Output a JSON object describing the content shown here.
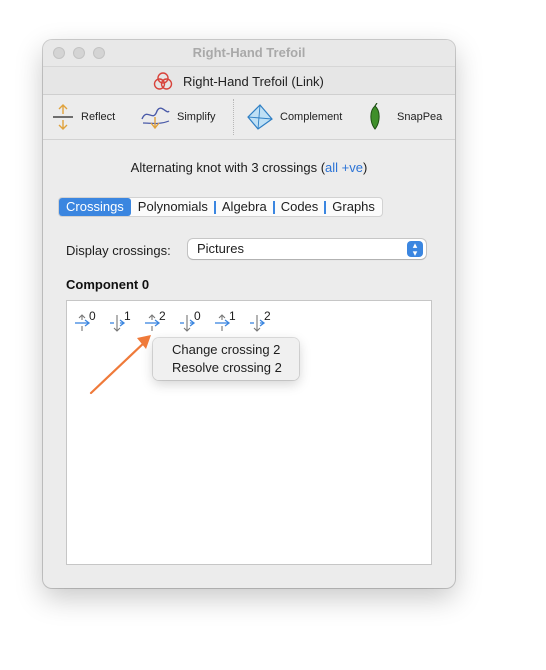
{
  "window": {
    "title": "Right-Hand Trefoil",
    "link_title": "Right-Hand Trefoil (Link)"
  },
  "toolbar": {
    "reflect_label": "Reflect",
    "simplify_label": "Simplify",
    "complement_label": "Complement",
    "snappea_label": "SnapPea"
  },
  "summary": {
    "text": "Alternating knot with 3 crossings (",
    "accent": "all +ve",
    "suffix": ")"
  },
  "tabs": [
    "Crossings",
    "Polynomials",
    "Algebra",
    "Codes",
    "Graphs"
  ],
  "active_tab": "Crossings",
  "display": {
    "label": "Display crossings:",
    "value": "Pictures"
  },
  "component": {
    "heading": "Component 0",
    "crossings": [
      {
        "index": "0",
        "type": "positive-up"
      },
      {
        "index": "1",
        "type": "negative-down"
      },
      {
        "index": "2",
        "type": "positive-up"
      },
      {
        "index": "0",
        "type": "negative-down"
      },
      {
        "index": "1",
        "type": "positive-up"
      },
      {
        "index": "2",
        "type": "negative-down"
      }
    ]
  },
  "context_menu": {
    "items": [
      "Change crossing 2",
      "Resolve crossing 2"
    ]
  },
  "colors": {
    "accent": "#3b86e0",
    "annotation_arrow": "#ef7a3a",
    "toolbar_icon_orange": "#e0a23c"
  }
}
